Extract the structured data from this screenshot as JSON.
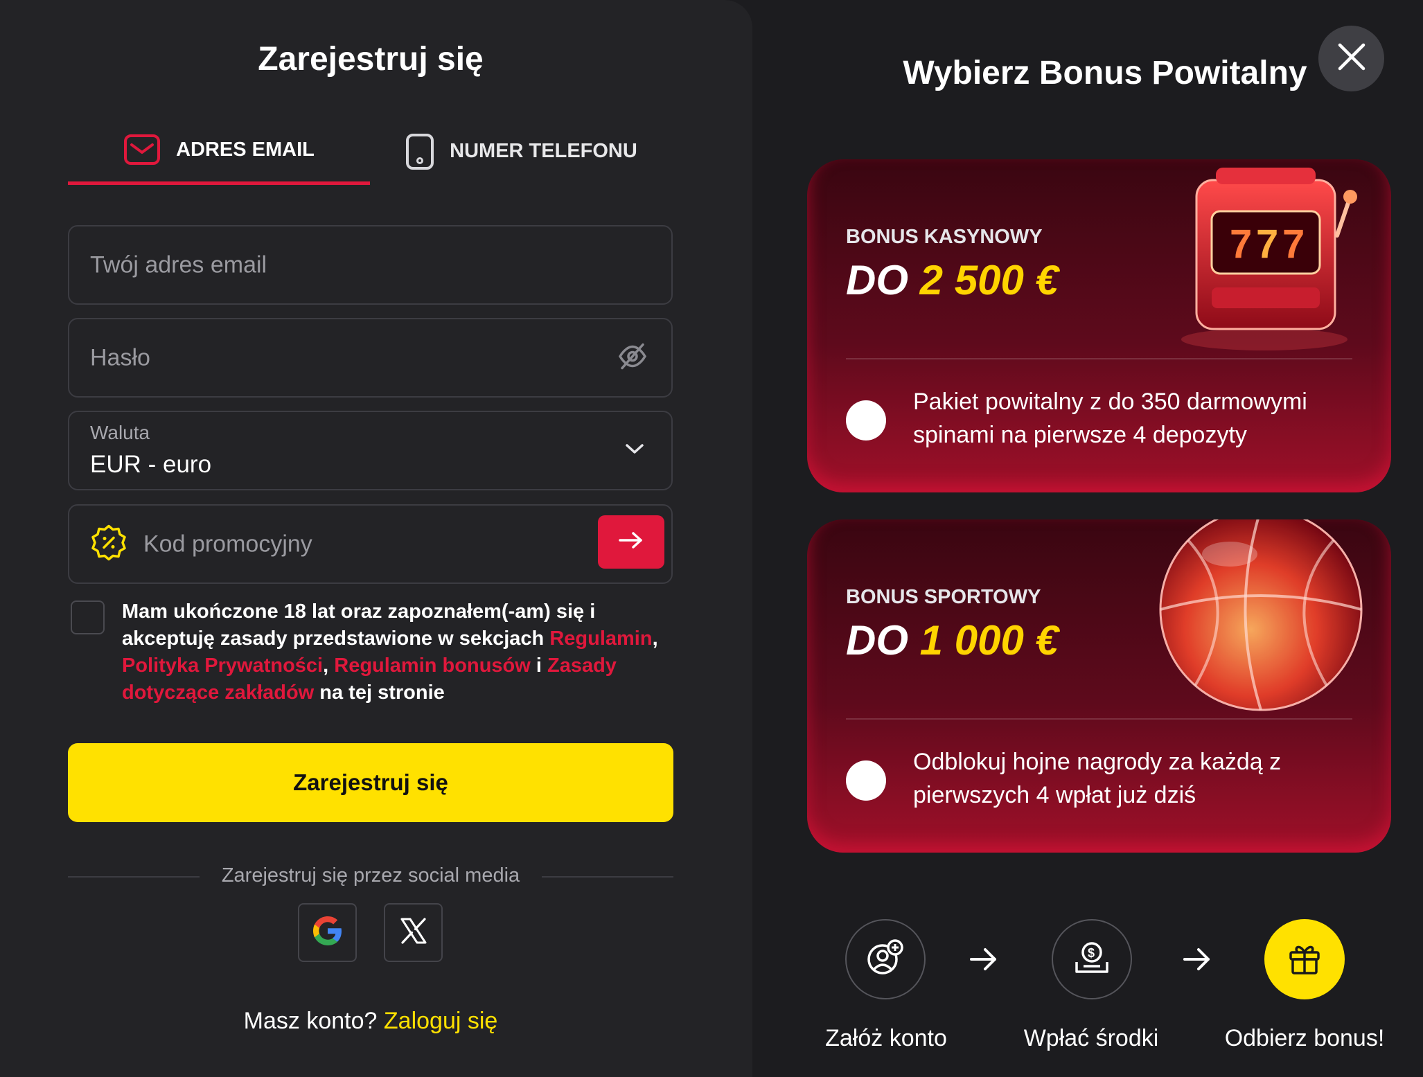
{
  "register": {
    "title": "Zarejestruj się",
    "tabs": [
      {
        "label": "ADRES EMAIL",
        "icon": "mail-icon",
        "active": true
      },
      {
        "label": "NUMER TELEFONU",
        "icon": "phone-icon",
        "active": false
      }
    ],
    "email": {
      "placeholder": "Twój adres email"
    },
    "password": {
      "placeholder": "Hasło"
    },
    "currency": {
      "label": "Waluta",
      "value": "EUR - euro"
    },
    "promo": {
      "placeholder": "Kod promocyjny"
    },
    "terms": {
      "part1": "Mam ukończone 18 lat oraz zapoznałem(-am) się i akceptuję zasady przedstawione w sekcjach ",
      "link1": "Regulamin",
      "sep1": ", ",
      "link2": "Polityka Prywatności",
      "sep2": ", ",
      "link3": "Regulamin bonusów",
      "sep3": " i ",
      "link4": "Zasady dotyczące zakładów",
      "part2": " na tej stronie"
    },
    "submit_label": "Zarejestruj się",
    "social_label": "Zarejestruj się przez social media",
    "login_prompt": "Masz konto?",
    "login_link": "Zaloguj się"
  },
  "bonus": {
    "title": "Wybierz Bonus Powitalny",
    "cards": [
      {
        "kind": "BONUS KASYNOWY",
        "prefix": "DO",
        "amount": "2 500 €",
        "description": "Pakiet powitalny z do 350 darmowymi spinami na pierwsze 4 depozyty"
      },
      {
        "kind": "BONUS SPORTOWY",
        "prefix": "DO",
        "amount": "1 000 €",
        "description": "Odblokuj hojne nagrody za każdą z pierwszych 4 wpłat już dziś"
      }
    ],
    "steps": [
      {
        "label": "Załóż konto",
        "icon": "add-user-icon"
      },
      {
        "label": "Wpłać środki",
        "icon": "deposit-icon"
      },
      {
        "label": "Odbierz bonus!",
        "icon": "gift-icon"
      }
    ]
  },
  "colors": {
    "accent_red": "#e0183c",
    "accent_yellow": "#ffe100",
    "panel": "#232326"
  }
}
